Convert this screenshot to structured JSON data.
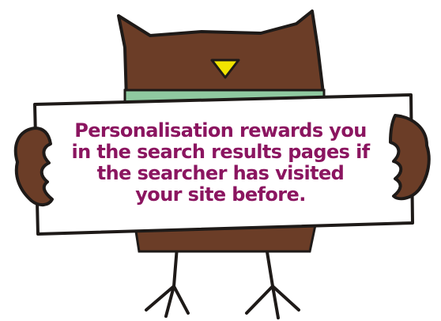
{
  "sign": {
    "lines": [
      "Personalisation rewards you",
      "in the search results pages if",
      "the searcher has visited",
      "your site before."
    ],
    "text_color": "#8b1560"
  },
  "owl": {
    "body_color": "#6b3d27",
    "beak_color": "#f1e400",
    "collar_color": "#8fc9a0"
  }
}
